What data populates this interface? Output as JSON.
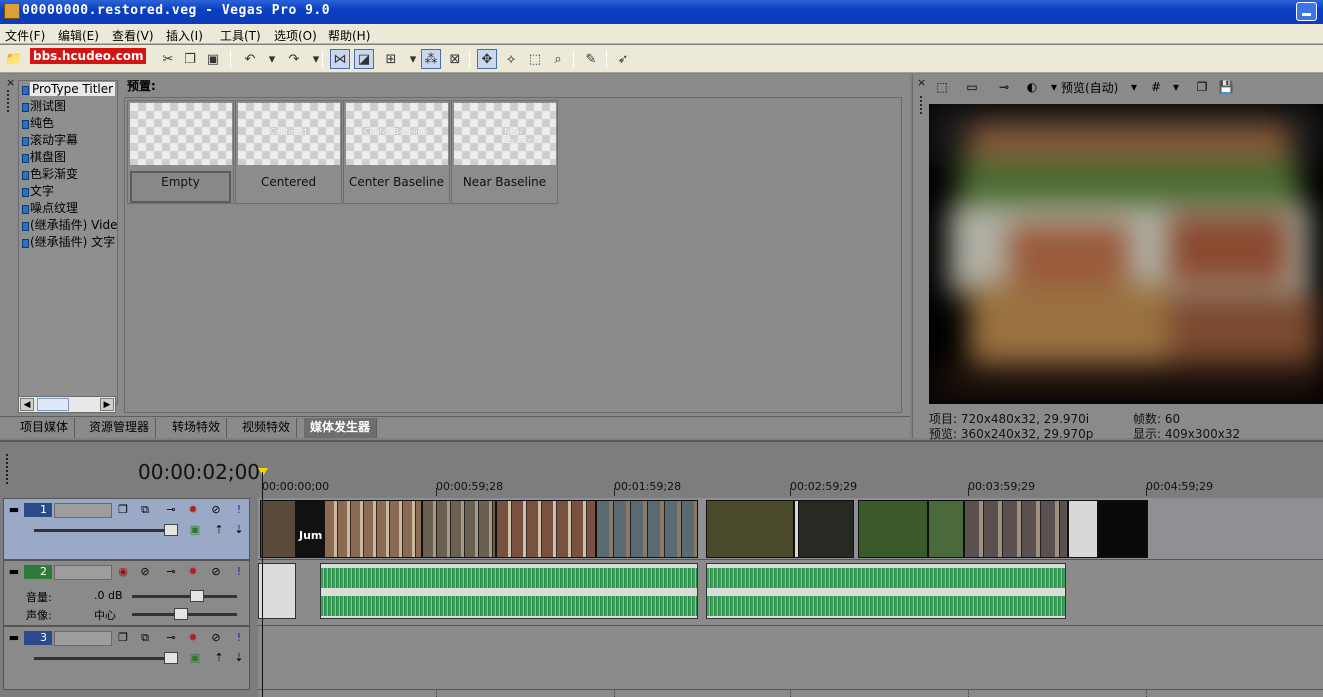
{
  "window": {
    "title": "00000000.restored.veg - Vegas Pro 9.0"
  },
  "watermark": {
    "text": "bbs.hcudeo.com"
  },
  "menu": [
    "文件(F)",
    "编辑(E)",
    "查看(V)",
    "插入(I)",
    "工具(T)",
    "选项(O)",
    "帮助(H)"
  ],
  "media_generator": {
    "tree": [
      "ProType Titler",
      "测试图",
      "纯色",
      "滚动字幕",
      "棋盘图",
      "色彩渐变",
      "文字",
      "噪点纹理",
      "(继承插件) Vide",
      "(继承插件) 文字"
    ],
    "presets_label": "预置:",
    "presets": [
      {
        "name": "Empty",
        "thumb_text": ""
      },
      {
        "name": "Centered",
        "thumb_text": "Centered"
      },
      {
        "name": "Center Baseline",
        "thumb_text": "Center Baseline"
      },
      {
        "name": "Near Baseline",
        "thumb_text": "Near Baseline"
      }
    ]
  },
  "tabs": [
    "项目媒体",
    "资源管理器",
    "转场特效",
    "视频特效",
    "媒体发生器"
  ],
  "preview": {
    "mode_label": "预览(自动)",
    "project_line": "项目: 720x480x32, 29.970i",
    "preview_line": "预览: 360x240x32, 29.970p",
    "frame_line": "帧数: 60",
    "display_line": "显示: 409x300x32"
  },
  "timeline": {
    "timecode": "00:00:02;00",
    "ruler": [
      "00:00:00;00",
      "00:00:59;28",
      "00:01:59;28",
      "00:02:59;29",
      "00:03:59;29",
      "00:04:59;29"
    ],
    "tracks": [
      {
        "number": "1",
        "type": "video"
      },
      {
        "number": "2",
        "type": "audio",
        "volume_label": "音量:",
        "volume_value": ".0 dB",
        "pan_label": "声像:",
        "pan_value": "中心"
      },
      {
        "number": "3",
        "type": "video"
      }
    ]
  }
}
